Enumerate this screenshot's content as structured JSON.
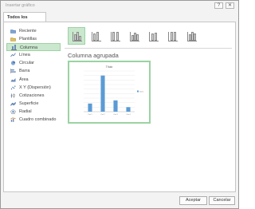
{
  "window": {
    "title": "Insertar gráfico"
  },
  "titlebar": {
    "help": "?",
    "close": "✕"
  },
  "tabs": [
    {
      "label": "Todos los gráficos"
    }
  ],
  "sidebar": {
    "items": [
      {
        "label": "Reciente",
        "icon": "folder-icon"
      },
      {
        "label": "Plantillas",
        "icon": "templates-icon"
      },
      {
        "label": "Columna",
        "icon": "column-chart-icon",
        "selected": true
      },
      {
        "label": "Línea",
        "icon": "line-chart-icon"
      },
      {
        "label": "Circular",
        "icon": "pie-chart-icon"
      },
      {
        "label": "Barra",
        "icon": "bar-chart-icon"
      },
      {
        "label": "Área",
        "icon": "area-chart-icon"
      },
      {
        "label": "X Y (Dispersión)",
        "icon": "scatter-chart-icon"
      },
      {
        "label": "Cotizaciones",
        "icon": "stock-chart-icon"
      },
      {
        "label": "Superficie",
        "icon": "surface-chart-icon"
      },
      {
        "label": "Radial",
        "icon": "radar-chart-icon"
      },
      {
        "label": "Cuadro combinado",
        "icon": "combo-chart-icon"
      }
    ]
  },
  "subtypes": [
    {
      "name": "clustered-column",
      "selected": true
    },
    {
      "name": "stacked-column"
    },
    {
      "name": "100-stacked-column"
    },
    {
      "name": "3d-clustered-column"
    },
    {
      "name": "3d-stacked-column"
    },
    {
      "name": "3d-100-stacked-column"
    },
    {
      "name": "3d-column"
    }
  ],
  "selected_subtype_title": "Columna agrupada",
  "chart_data": {
    "type": "bar",
    "title": "Título",
    "categories": [
      "Cat 1",
      "Cat 2",
      "Cat 3",
      "Cat 4"
    ],
    "series": [
      {
        "name": "Serie",
        "values": [
          18,
          80,
          25,
          10
        ]
      }
    ],
    "ylim": [
      0,
      90
    ],
    "y_ticks": [
      "",
      "",
      "",
      "",
      "",
      "",
      "",
      "",
      "",
      ""
    ],
    "bar_color": "#5b9bd5",
    "grid": true,
    "legend_position": "right"
  },
  "buttons": {
    "ok": "Aceptar",
    "cancel": "Cancelar"
  },
  "colors": {
    "accent": "#9ad3a2",
    "selected_bg": "#c9e8cd"
  }
}
